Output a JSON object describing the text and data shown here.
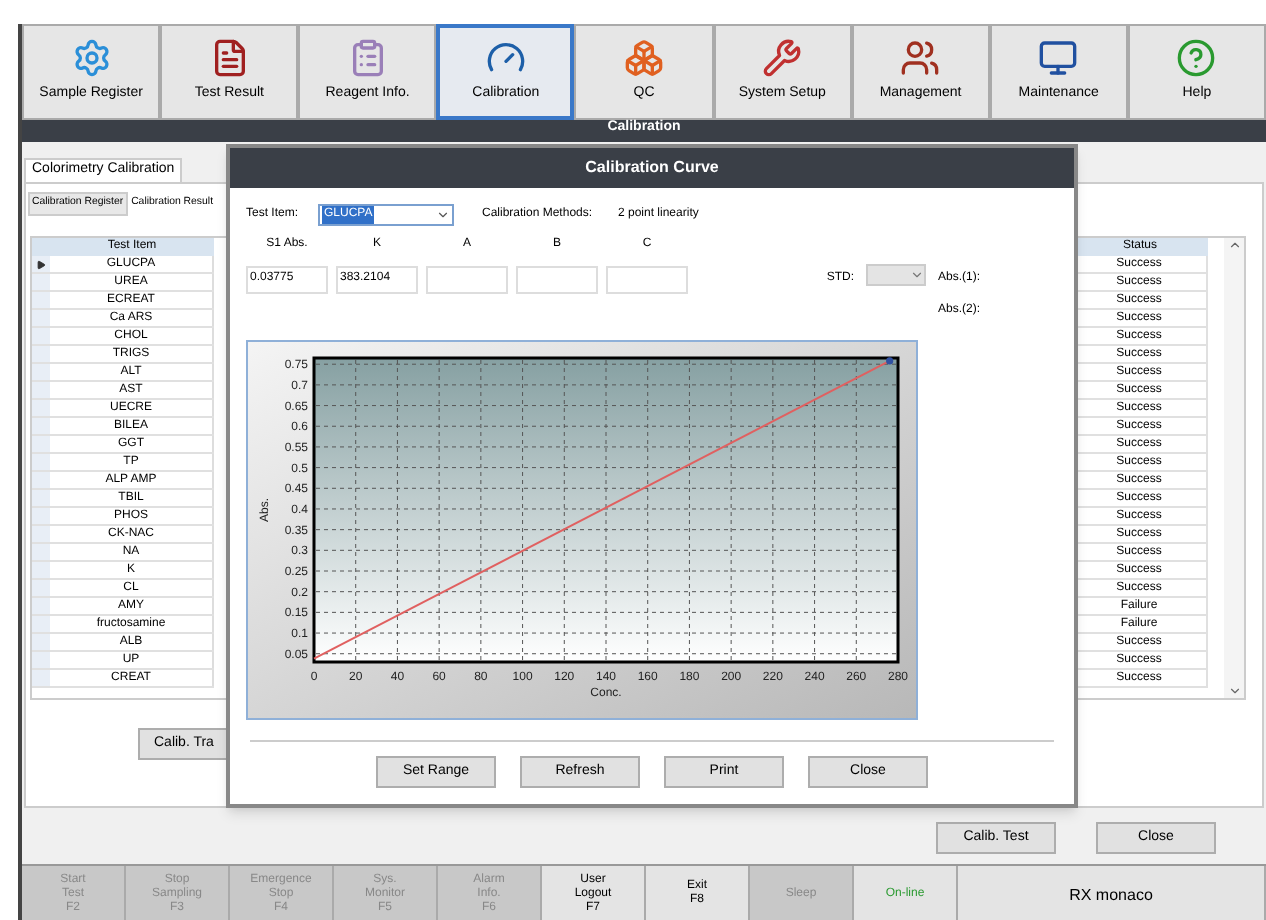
{
  "toolbar": [
    {
      "label": "Sample Register",
      "selected": false
    },
    {
      "label": "Test Result",
      "selected": false
    },
    {
      "label": "Reagent Info.",
      "selected": false
    },
    {
      "label": "Calibration",
      "selected": true
    },
    {
      "label": "QC",
      "selected": false
    },
    {
      "label": "System Setup",
      "selected": false
    },
    {
      "label": "Management",
      "selected": false
    },
    {
      "label": "Maintenance",
      "selected": false
    },
    {
      "label": "Help",
      "selected": false
    }
  ],
  "page_title": "Calibration",
  "tabs": [
    {
      "label": "Colorimetry Calibration",
      "selected": true
    }
  ],
  "subtabs": [
    {
      "label": "Calibration Register",
      "selected": false
    },
    {
      "label": "Calibration Result",
      "selected": true
    }
  ],
  "table": {
    "columns": [
      "Test Item",
      "Status"
    ],
    "rows": [
      {
        "test_item": "GLUCPA",
        "status": "Success",
        "selected": true
      },
      {
        "test_item": "UREA",
        "status": "Success",
        "selected": false
      },
      {
        "test_item": "ECREAT",
        "status": "Success",
        "selected": false
      },
      {
        "test_item": "Ca ARS",
        "status": "Success",
        "selected": false
      },
      {
        "test_item": "CHOL",
        "status": "Success",
        "selected": false
      },
      {
        "test_item": "TRIGS",
        "status": "Success",
        "selected": false
      },
      {
        "test_item": "ALT",
        "status": "Success",
        "selected": false
      },
      {
        "test_item": "AST",
        "status": "Success",
        "selected": false
      },
      {
        "test_item": "UECRE",
        "status": "Success",
        "selected": false
      },
      {
        "test_item": "BILEA",
        "status": "Success",
        "selected": false
      },
      {
        "test_item": "GGT",
        "status": "Success",
        "selected": false
      },
      {
        "test_item": "TP",
        "status": "Success",
        "selected": false
      },
      {
        "test_item": "ALP AMP",
        "status": "Success",
        "selected": false
      },
      {
        "test_item": "TBIL",
        "status": "Success",
        "selected": false
      },
      {
        "test_item": "PHOS",
        "status": "Success",
        "selected": false
      },
      {
        "test_item": "CK-NAC",
        "status": "Success",
        "selected": false
      },
      {
        "test_item": "NA",
        "status": "Success",
        "selected": false
      },
      {
        "test_item": "K",
        "status": "Success",
        "selected": false
      },
      {
        "test_item": "CL",
        "status": "Success",
        "selected": false
      },
      {
        "test_item": "AMY",
        "status": "Failure",
        "selected": false
      },
      {
        "test_item": "fructosamine",
        "status": "Failure",
        "selected": false
      },
      {
        "test_item": "ALB",
        "status": "Success",
        "selected": false
      },
      {
        "test_item": "UP",
        "status": "Success",
        "selected": false
      },
      {
        "test_item": "CREAT",
        "status": "Success",
        "selected": false
      }
    ]
  },
  "trace_button": "Calib. Tra",
  "footer_buttons": [
    "Calib. Test",
    "Close"
  ],
  "dialog": {
    "title": "Calibration Curve",
    "test_item_label": "Test Item:",
    "test_item_value": "GLUCPA",
    "method_label": "Calibration Methods:",
    "method_value": "2 point linearity",
    "params": [
      {
        "label": "S1 Abs.",
        "value": "0.03775"
      },
      {
        "label": "K",
        "value": "383.2104"
      },
      {
        "label": "A"
      },
      {
        "label": "B"
      },
      {
        "label": "C"
      }
    ],
    "std_label": "STD:",
    "abs_labels": [
      "Abs.(1):",
      "Abs.(2):"
    ],
    "chart_data": {
      "type": "line",
      "xlabel": "Conc.",
      "ylabel": "Abs.",
      "x": [
        0,
        276
      ],
      "series": [
        {
          "color": "#e06060",
          "values": [
            0.038,
            0.758
          ]
        }
      ],
      "grid": true,
      "xlim": [
        0,
        280
      ],
      "ylim": [
        0.03,
        0.765
      ],
      "xticks": [
        0,
        20,
        40,
        60,
        80,
        100,
        120,
        140,
        160,
        180,
        200,
        220,
        240,
        260,
        280
      ],
      "yticks": [
        0.05,
        0.1,
        0.15,
        0.2,
        0.25,
        0.3,
        0.35,
        0.4,
        0.45,
        0.5,
        0.55,
        0.6,
        0.65,
        0.7,
        0.75
      ]
    },
    "buttons": [
      "Set Range",
      "Refresh",
      "Print",
      "Close"
    ]
  },
  "status_bar": [
    {
      "kind": "key",
      "lines": [
        "Start",
        "Test",
        "F2"
      ],
      "disabled": true
    },
    {
      "kind": "key",
      "lines": [
        "Stop",
        "Sampling",
        "F3"
      ],
      "disabled": true
    },
    {
      "kind": "key",
      "lines": [
        "Emergence",
        "Stop",
        "F4"
      ],
      "disabled": true
    },
    {
      "kind": "key",
      "lines": [
        "Sys.",
        "Monitor",
        "F5"
      ],
      "disabled": true
    },
    {
      "kind": "key",
      "lines": [
        "Alarm",
        "Info.",
        "F6"
      ],
      "disabled": true
    },
    {
      "kind": "key",
      "lines": [
        "User",
        "Logout",
        "F7"
      ],
      "disabled": false
    },
    {
      "kind": "key",
      "lines": [
        "Exit",
        "F8"
      ],
      "disabled": false
    },
    {
      "kind": "key",
      "lines": [
        "Sleep"
      ],
      "disabled": true
    },
    {
      "kind": "connection",
      "lines": [
        "On-line"
      ]
    },
    {
      "kind": "device",
      "lines": [
        "RX monaco"
      ]
    }
  ]
}
